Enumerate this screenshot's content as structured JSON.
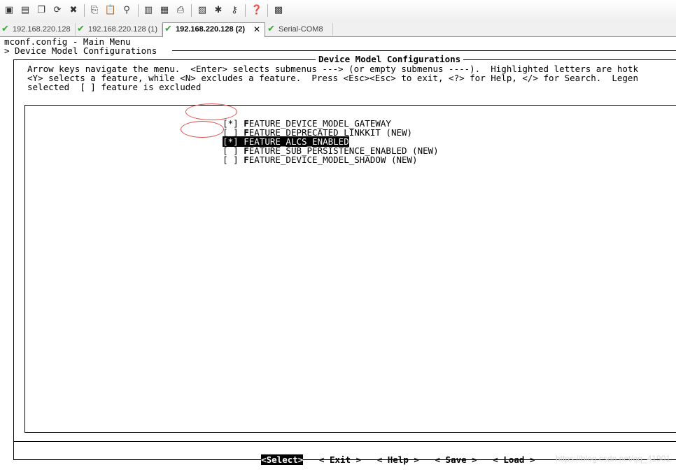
{
  "toolbar": {
    "buttons": [
      "new-session-icon",
      "open-session-icon",
      "duplicate-session-icon",
      "reconnect-icon",
      "disconnect-icon",
      "copy-icon",
      "paste-icon",
      "find-icon",
      "print-setup-icon",
      "print-icon",
      "print-selection-icon",
      "session-options-icon",
      "global-options-icon",
      "keymap-icon",
      "help-icon",
      "screen-icon"
    ]
  },
  "tabs": [
    {
      "label": "192.168.220.128",
      "active": false
    },
    {
      "label": "192.168.220.128 (1)",
      "active": false
    },
    {
      "label": "192.168.220.128 (2)",
      "active": true,
      "close": "✕"
    },
    {
      "label": "Serial-COM8",
      "active": false
    }
  ],
  "terminal": {
    "header_line1": "mconf.config - Main Menu",
    "header_line2": "> Device Model Configurations",
    "dialog_title": "Device Model Configurations",
    "help_line1": "Arrow keys navigate the menu.  <Enter> selects submenus ---> (or empty submenus ----).  Highlighted letters are hotk",
    "help_line2": "<Y> selects a feature, while <N> excludes a feature.  Press <Esc><Esc> to exit, <?> for Help, </> for Search.  Legen",
    "help_line3": "selected  [ ] feature is excluded",
    "items": [
      {
        "mark": "[*]",
        "hotkey": "F",
        "rest": "EATURE_DEVICE_MODEL_GATEWAY",
        "highlight": false
      },
      {
        "mark": "[ ]",
        "hotkey": "F",
        "rest": "EATURE_DEPRECATED_LINKKIT (NEW)",
        "highlight": false
      },
      {
        "mark": "[*]",
        "hotkey": "F",
        "rest": "EATURE_ALCS_ENABLED",
        "highlight": true
      },
      {
        "mark": "[ ]",
        "hotkey": "F",
        "rest": "EATURE_SUB_PERSISTENCE_ENABLED (NEW)",
        "highlight": false
      },
      {
        "mark": "[ ]",
        "hotkey": "F",
        "rest": "EATURE_DEVICE_MODEL_SHADOW (NEW)",
        "highlight": false
      }
    ],
    "buttons": {
      "select": "<Select>",
      "exit": "< Exit >",
      "help": "< Help >",
      "save": "< Save >",
      "load": "< Load >"
    }
  },
  "watermark": "https://blog.csdn.net/qq_41901"
}
